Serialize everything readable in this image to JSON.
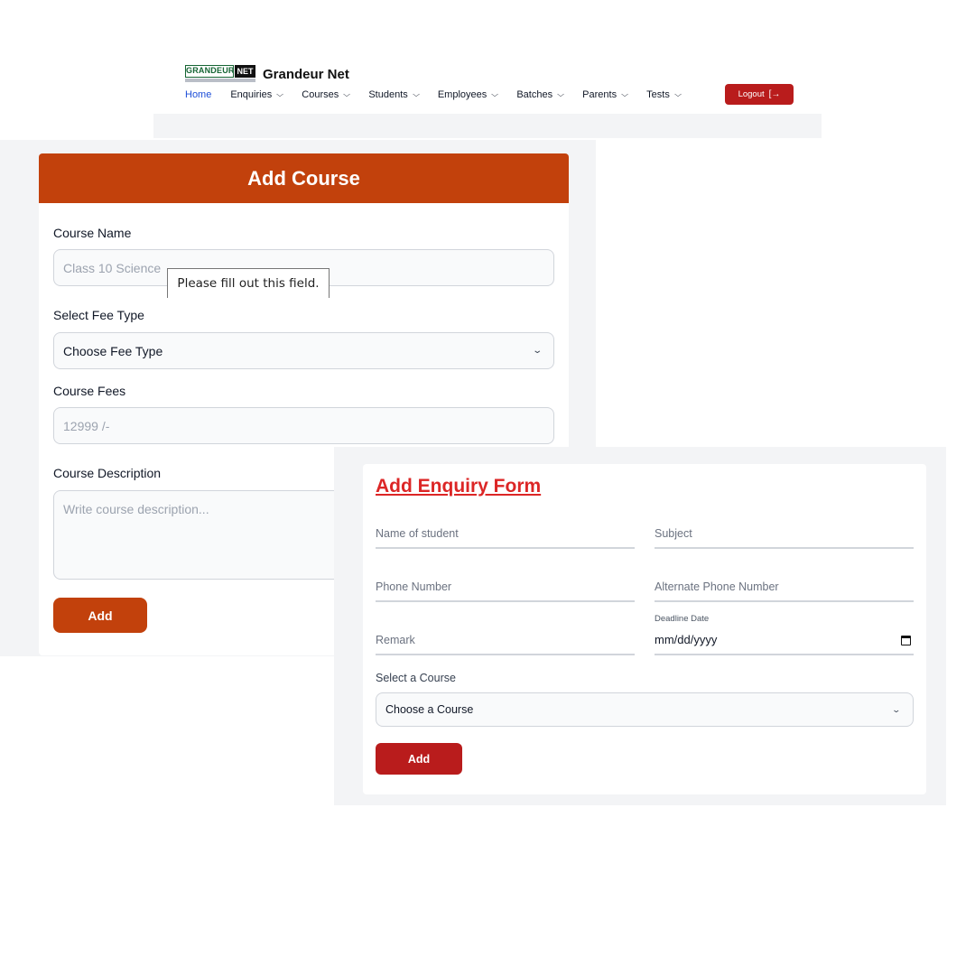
{
  "navbar": {
    "logo": {
      "left_text": "GRANDEUR",
      "right_text": "NET",
      "tagline": "DIGITAL MARKETING & IT SERVICES"
    },
    "brand_name": "Grandeur Net",
    "menu": [
      {
        "label": "Home",
        "active": true,
        "dropdown": false
      },
      {
        "label": "Enquiries",
        "dropdown": true
      },
      {
        "label": "Courses",
        "dropdown": true
      },
      {
        "label": "Students",
        "dropdown": true
      },
      {
        "label": "Employees",
        "dropdown": true
      },
      {
        "label": "Batches",
        "dropdown": true
      },
      {
        "label": "Parents",
        "dropdown": true
      },
      {
        "label": "Tests",
        "dropdown": true
      }
    ],
    "logout_label": "Logout",
    "chevron": "⌄",
    "logout_icon": "[→"
  },
  "add_course": {
    "title": "Add Course",
    "course_name_label": "Course Name",
    "course_name_placeholder": "Class 10 Science",
    "fee_type_label": "Select Fee Type",
    "fee_type_value": "Choose Fee Type",
    "course_fees_label": "Course Fees",
    "course_fees_placeholder": "12999 /-",
    "description_label": "Course Description",
    "description_placeholder": "Write course description...",
    "add_label": "Add",
    "validation_tooltip": "Please fill out this field."
  },
  "enquiry": {
    "title": "Add Enquiry Form",
    "fields": {
      "name": "Name of student",
      "subject": "Subject",
      "phone": "Phone Number",
      "alt_phone": "Alternate Phone Number",
      "remark": "Remark",
      "deadline_label": "Deadline Date",
      "deadline_value": "mm/dd/yyyy"
    },
    "course_label": "Select a Course",
    "course_value": "Choose a Course",
    "add_label": "Add"
  },
  "colors": {
    "course_header": "#c2410c",
    "logout": "#b91c1c",
    "enquiry_title": "#dc2626",
    "active_nav": "#1d4ed8"
  },
  "icons": {
    "select_chevron": "chevron-down-icon",
    "calendar": "calendar-icon",
    "logout": "logout-icon"
  }
}
